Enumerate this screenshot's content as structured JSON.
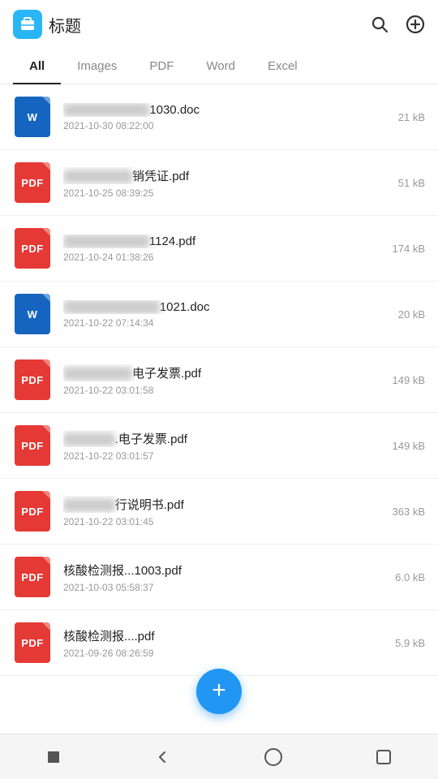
{
  "header": {
    "title": "标题",
    "logo_bg": "#29B6F6",
    "search_label": "搜索",
    "add_label": "添加"
  },
  "filter_tabs": [
    {
      "id": "all",
      "label": "All",
      "active": true
    },
    {
      "id": "images",
      "label": "Images",
      "active": false
    },
    {
      "id": "pdf",
      "label": "PDF",
      "active": false
    },
    {
      "id": "word",
      "label": "Word",
      "active": false
    },
    {
      "id": "excel",
      "label": "Excel",
      "active": false
    }
  ],
  "files": [
    {
      "type": "word",
      "type_label": "W",
      "name_blurred": "██████████",
      "name_suffix": "1030.doc",
      "date": "2021-10-30 08:22:00",
      "size": "21 kB"
    },
    {
      "type": "pdf",
      "type_label": "PDF",
      "name_blurred": "████████",
      "name_suffix": "销凭证.pdf",
      "date": "2021-10-25 08:39:25",
      "size": "51 kB"
    },
    {
      "type": "pdf",
      "type_label": "PDF",
      "name_blurred": "████████2...",
      "name_suffix": "1124.pdf",
      "date": "2021-10-24 01:38:26",
      "size": "174 kB"
    },
    {
      "type": "word",
      "type_label": "W",
      "name_blurred": "██████████...",
      "name_suffix": "1021.doc",
      "date": "2021-10-22 07:14:34",
      "size": "20 kB"
    },
    {
      "type": "pdf",
      "type_label": "PDF",
      "name_blurred": "████████",
      "name_suffix": "电子发票.pdf",
      "date": "2021-10-22 03:01:58",
      "size": "149 kB"
    },
    {
      "type": "pdf",
      "type_label": "PDF",
      "name_blurred": "██████",
      "name_suffix": ".电子发票.pdf",
      "date": "2021-10-22 03:01:57",
      "size": "149 kB"
    },
    {
      "type": "pdf",
      "type_label": "PDF",
      "name_blurred": "██████",
      "name_suffix": "行说明书.pdf",
      "date": "2021-10-22 03:01:45",
      "size": "363 kB"
    },
    {
      "type": "pdf",
      "type_label": "PDF",
      "name_blurred": "",
      "name_suffix": "核酸检测报...1003.pdf",
      "date": "2021-10-03 05:58:37",
      "size": "6.0 kB"
    },
    {
      "type": "pdf",
      "type_label": "PDF",
      "name_blurred": "",
      "name_suffix": "核酸检测报....pdf",
      "date": "2021-09-26 08:26:59",
      "size": "5.9 kB"
    }
  ],
  "fab": {
    "label": "+"
  },
  "bottom_nav": {
    "back": "◁",
    "home": "○",
    "recent": "□",
    "square": "■"
  }
}
